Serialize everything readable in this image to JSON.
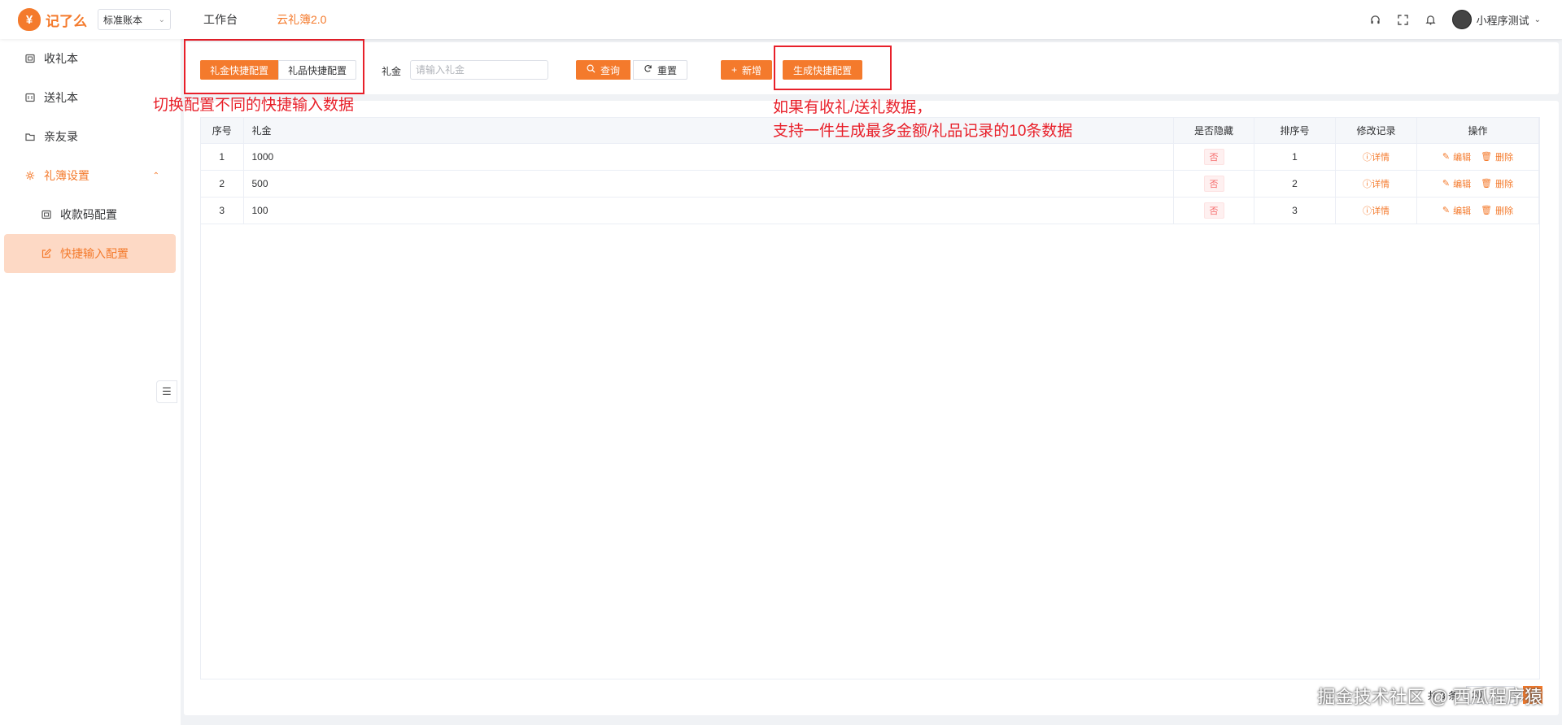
{
  "header": {
    "logo_icon": "¥",
    "logo_text": "记了么",
    "ledger_select": "标准账本",
    "nav": [
      "工作台",
      "云礼簿2.0"
    ],
    "user_name": "小程序测试"
  },
  "sidebar": {
    "items": [
      {
        "label": "收礼本",
        "icon": "ledger-icon"
      },
      {
        "label": "送礼本",
        "icon": "ledger-out-icon"
      },
      {
        "label": "亲友录",
        "icon": "folder-icon"
      },
      {
        "label": "礼簿设置",
        "icon": "gear-icon"
      },
      {
        "label": "收款码配置",
        "icon": "qrcode-icon"
      },
      {
        "label": "快捷输入配置",
        "icon": "edit-icon"
      }
    ]
  },
  "search": {
    "tabs": [
      "礼金快捷配置",
      "礼品快捷配置"
    ],
    "field_label": "礼金",
    "placeholder": "请输入礼金",
    "query": "查询",
    "reset": "重置",
    "add": "新增",
    "generate": "生成快捷配置"
  },
  "table": {
    "headers": [
      "序号",
      "礼金",
      "是否隐藏",
      "排序号",
      "修改记录",
      "操作"
    ],
    "rows": [
      {
        "index": "1",
        "amount": "1000",
        "hidden": "否",
        "sort": "1",
        "record": "详情",
        "edit": "编辑",
        "delete": "删除"
      },
      {
        "index": "2",
        "amount": "500",
        "hidden": "否",
        "sort": "2",
        "record": "详情",
        "edit": "编辑",
        "delete": "删除"
      },
      {
        "index": "3",
        "amount": "100",
        "hidden": "否",
        "sort": "3",
        "record": "详情",
        "edit": "编辑",
        "delete": "删除"
      }
    ]
  },
  "pagination": {
    "total": "共 3 条",
    "page_size": "20",
    "current_page": "1"
  },
  "annotations": {
    "left_note": "切换配置不同的快捷输入数据",
    "right_note_line1": "如果有收礼/送礼数据，",
    "right_note_line2": "支持一件生成最多金额/礼品记录的10条数据"
  },
  "watermark": "掘金技术社区 @ 西瓜程序猿",
  "colors": {
    "accent": "#f47a2c",
    "annotation": "#e8202a",
    "active_bg": "#fdd9c5"
  }
}
